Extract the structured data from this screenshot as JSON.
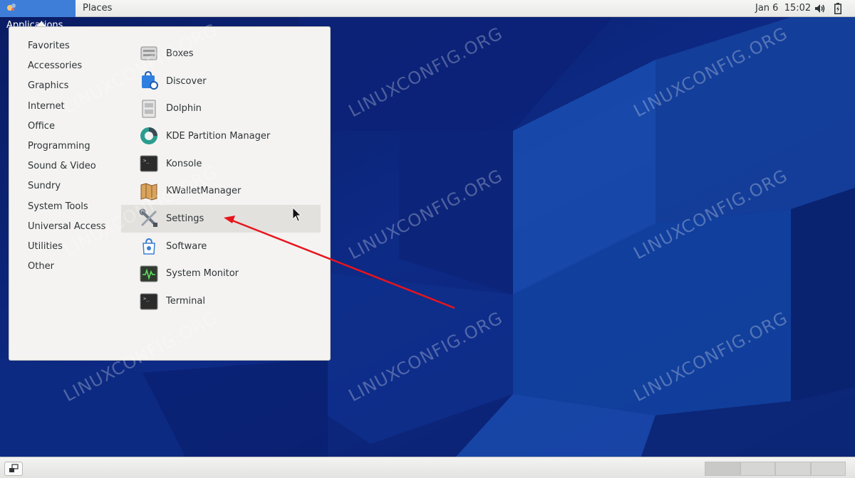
{
  "topbar": {
    "applications_label": "Applications",
    "places_label": "Places",
    "datetime": "Jan 6  15:02",
    "volume_icon": "volume-icon",
    "battery_icon": "battery-icon"
  },
  "menu": {
    "categories": [
      "Favorites",
      "Accessories",
      "Graphics",
      "Internet",
      "Office",
      "Programming",
      "Sound & Video",
      "Sundry",
      "System Tools",
      "Universal Access",
      "Utilities",
      "Other"
    ],
    "apps": [
      {
        "label": "Boxes",
        "icon": "boxes-icon"
      },
      {
        "label": "Discover",
        "icon": "discover-icon"
      },
      {
        "label": "Dolphin",
        "icon": "dolphin-icon"
      },
      {
        "label": "KDE Partition Manager",
        "icon": "partition-manager-icon"
      },
      {
        "label": "Konsole",
        "icon": "konsole-icon"
      },
      {
        "label": "KWalletManager",
        "icon": "kwallet-icon"
      },
      {
        "label": "Settings",
        "icon": "settings-icon",
        "highlighted": true
      },
      {
        "label": "Software",
        "icon": "software-icon"
      },
      {
        "label": "System Monitor",
        "icon": "system-monitor-icon"
      },
      {
        "label": "Terminal",
        "icon": "terminal-icon"
      }
    ]
  },
  "watermark": "LINUXCONFIG.ORG",
  "colors": {
    "accent": "#3f7ed8",
    "arrow": "#e8141b",
    "desktop_dark": "#071a5c",
    "desktop_light": "#1a4fb0"
  }
}
